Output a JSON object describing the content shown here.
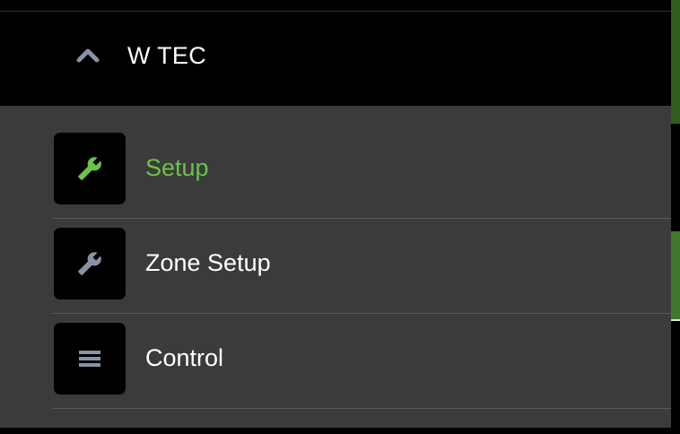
{
  "group": {
    "title": "W TEC",
    "expanded": true,
    "chevron_icon": "chevron-up-icon"
  },
  "items": [
    {
      "label": "Setup",
      "icon": "wrench-icon",
      "active": true,
      "active_color": "#6cc24a"
    },
    {
      "label": "Zone Setup",
      "icon": "wrench-icon",
      "active": false
    },
    {
      "label": "Control",
      "icon": "hamburger-menu-icon",
      "active": false
    }
  ],
  "colors": {
    "background": "#000000",
    "panel": "#3b3b3b",
    "accent_green": "#6cc24a",
    "icon_gray": "#8a93a3",
    "scrollbar_green": "#3f7a2a"
  }
}
